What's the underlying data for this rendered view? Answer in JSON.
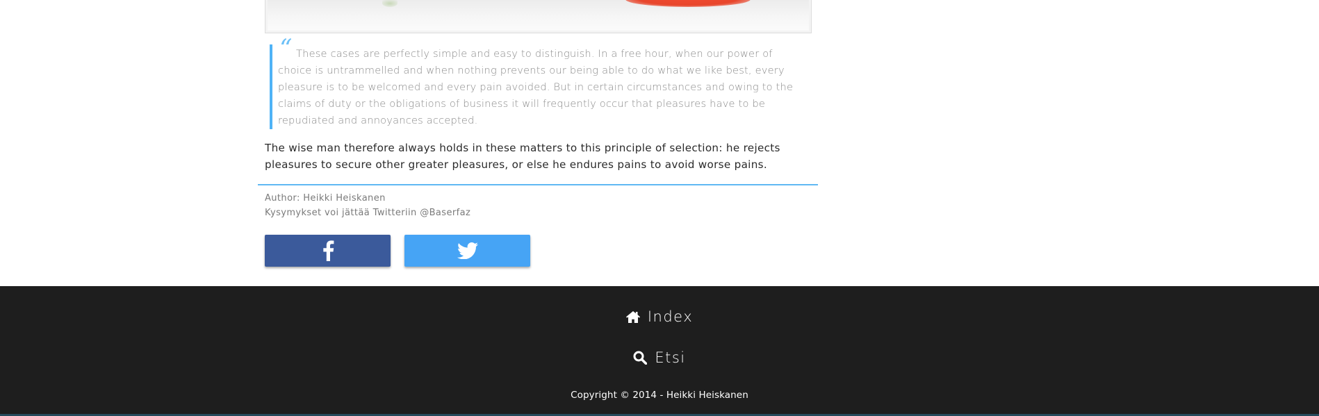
{
  "article": {
    "quote_mark": "“",
    "quote": "These cases are perfectly simple and easy to distinguish. In a free hour, when our power of choice is untrammelled and when nothing prevents our being able to do what we like best, every pleasure is to be welcomed and every pain avoided. But in certain circumstances and owing to the claims of duty or the obligations of business it will frequently occur that pleasures have to be repudiated and annoyances accepted.",
    "body": "The wise man therefore always holds in these matters to this principle of selection: he rejects pleasures to secure other greater pleasures, or else he endures pains to avoid worse pains.",
    "author_line": "Author: Heikki Heiskanen",
    "twitter_line": "Kysymykset voi jättää Twitteriin @Baserfaz"
  },
  "share": {
    "facebook_icon": "facebook-icon",
    "twitter_icon": "twitter-icon"
  },
  "footer": {
    "index_label": "Index",
    "search_label": "Etsi",
    "copyright": "Copyright © 2014 - Heikki Heiskanen"
  },
  "colors": {
    "accent": "#4fb3f6",
    "facebook": "#3b5a9b",
    "twitter": "#46a4f5",
    "footer_bg": "#1e1e1e"
  }
}
